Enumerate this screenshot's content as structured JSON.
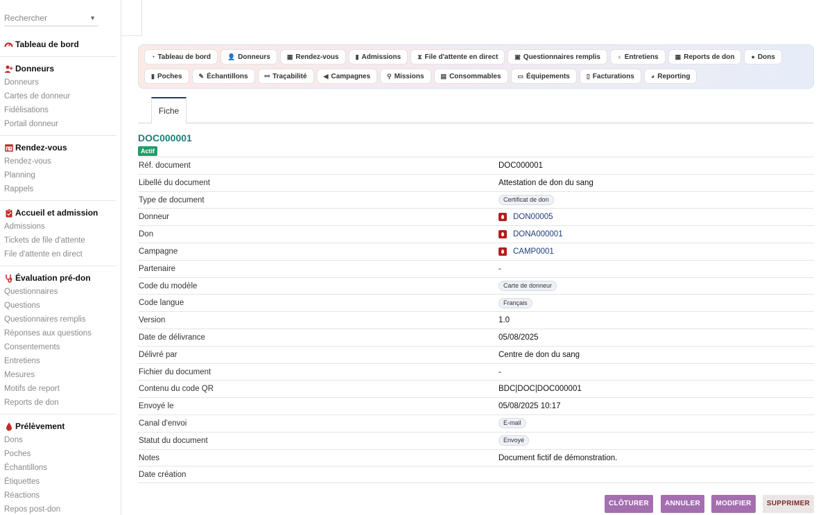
{
  "sidebar": {
    "search_placeholder": "Rechercher",
    "dashboard_label": "Tableau de bord",
    "sections": {
      "donneurs": {
        "title": "Donneurs",
        "items": [
          "Donneurs",
          "Cartes de donneur",
          "Fidélisations",
          "Portail donneur"
        ]
      },
      "rdv": {
        "title": "Rendez-vous",
        "items": [
          "Rendez-vous",
          "Planning",
          "Rappels"
        ]
      },
      "accueil": {
        "title": "Accueil et admission",
        "items": [
          "Admissions",
          "Tickets de file d'attente",
          "File d'attente en direct"
        ]
      },
      "eval": {
        "title": "Évaluation pré-don",
        "items": [
          "Questionnaires",
          "Questions",
          "Questionnaires remplis",
          "Réponses aux questions",
          "Consentements",
          "Entretiens",
          "Mesures",
          "Motifs de report",
          "Reports de don"
        ]
      },
      "prelev": {
        "title": "Prélèvement",
        "items": [
          "Dons",
          "Poches",
          "Échantillons",
          "Étiquettes",
          "Réactions",
          "Repos post-don"
        ]
      }
    }
  },
  "nav": {
    "row1": [
      {
        "label": "Tableau de bord",
        "icon": "gauge-icon"
      },
      {
        "label": "Donneurs",
        "icon": "user-plus-icon"
      },
      {
        "label": "Rendez-vous",
        "icon": "calendar-icon"
      },
      {
        "label": "Admissions",
        "icon": "clipboard-icon"
      },
      {
        "label": "File d'attente en direct",
        "icon": "hourglass-icon"
      },
      {
        "label": "Questionnaires remplis",
        "icon": "list-icon"
      },
      {
        "label": "Entretiens",
        "icon": "stethoscope-icon"
      },
      {
        "label": "Reports de don",
        "icon": "calendar-x-icon"
      },
      {
        "label": "Dons",
        "icon": "drop-icon"
      }
    ],
    "row2": [
      {
        "label": "Poches",
        "icon": "bag-icon"
      },
      {
        "label": "Échantillons",
        "icon": "pipette-icon"
      },
      {
        "label": "Traçabilité",
        "icon": "network-icon"
      },
      {
        "label": "Campagnes",
        "icon": "megaphone-icon"
      },
      {
        "label": "Missions",
        "icon": "route-icon"
      },
      {
        "label": "Consommables",
        "icon": "boxes-icon"
      },
      {
        "label": "Équipements",
        "icon": "monitor-icon"
      },
      {
        "label": "Facturations",
        "icon": "invoice-icon"
      },
      {
        "label": "Reporting",
        "icon": "pie-chart-icon"
      }
    ]
  },
  "tab": {
    "label": "Fiche"
  },
  "record": {
    "title": "DOC000001",
    "status_badge": "Actif",
    "fields": {
      "ref": {
        "label": "Réf. document",
        "value": "DOC000001"
      },
      "libelle": {
        "label": "Libellé du document",
        "value": "Attestation de don du sang"
      },
      "type": {
        "label": "Type de document",
        "value": "Certificat de don"
      },
      "donneur": {
        "label": "Donneur",
        "value": "DON00005"
      },
      "don": {
        "label": "Don",
        "value": "DONA000001"
      },
      "campagne": {
        "label": "Campagne",
        "value": "CAMP0001"
      },
      "partenaire": {
        "label": "Partenaire",
        "value": "-"
      },
      "modele": {
        "label": "Code du modèle",
        "value": "Carte de donneur"
      },
      "langue": {
        "label": "Code langue",
        "value": "Français"
      },
      "version": {
        "label": "Version",
        "value": "1.0"
      },
      "date_delivrance": {
        "label": "Date de délivrance",
        "value": "05/08/2025"
      },
      "delivre_par": {
        "label": "Délivré par",
        "value": "Centre de don du sang"
      },
      "fichier": {
        "label": "Fichier du document",
        "value": "-"
      },
      "qr": {
        "label": "Contenu du code QR",
        "value": "BDC|DOC|DOC000001"
      },
      "envoye_le": {
        "label": "Envoyé le",
        "value": "05/08/2025 10:17"
      },
      "canal": {
        "label": "Canal d'envoi",
        "value": "E-mail"
      },
      "statut": {
        "label": "Statut du document",
        "value": "Envoyé"
      },
      "notes": {
        "label": "Notes",
        "value": "Document fictif de démonstration."
      },
      "date_creation": {
        "label": "Date création",
        "value": ""
      }
    }
  },
  "actions": {
    "cloturer": "CLÔTURER",
    "annuler": "ANNULER",
    "modifier": "MODIFIER",
    "supprimer": "SUPPRIMER"
  },
  "colors": {
    "accent_title": "#1a7f78",
    "action_primary": "#a46eb1",
    "status_active": "#1e9e6a",
    "section_icon": "#c62828"
  }
}
